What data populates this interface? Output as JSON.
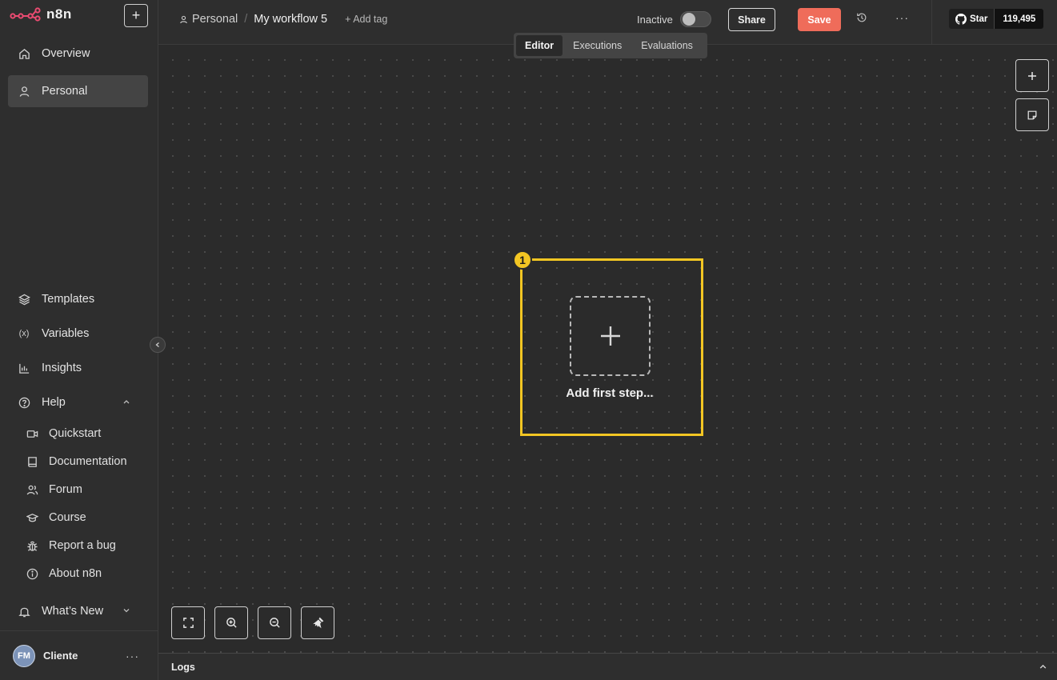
{
  "app": {
    "logo_text": "n8n",
    "new_button": "+"
  },
  "sidebar": {
    "top_items": [
      {
        "label": "Overview",
        "icon": "home-icon"
      },
      {
        "label": "Personal",
        "icon": "user-icon",
        "active": true
      }
    ],
    "bottom_items": [
      {
        "label": "Templates",
        "icon": "templates-icon"
      },
      {
        "label": "Variables",
        "icon": "variables-icon"
      },
      {
        "label": "Insights",
        "icon": "chart-icon"
      },
      {
        "label": "Help",
        "icon": "help-icon"
      }
    ],
    "help_items": [
      {
        "label": "Quickstart",
        "icon": "video-icon"
      },
      {
        "label": "Documentation",
        "icon": "book-icon"
      },
      {
        "label": "Forum",
        "icon": "users-icon"
      },
      {
        "label": "Course",
        "icon": "graduation-cap-icon"
      },
      {
        "label": "Report a bug",
        "icon": "bug-icon"
      },
      {
        "label": "About n8n",
        "icon": "info-icon"
      }
    ],
    "whats_new": "What’s New",
    "user": {
      "initials": "FM",
      "name": "Cliente"
    }
  },
  "header": {
    "project": "Personal",
    "separator": "/",
    "workflow_title": "My workflow 5",
    "add_tag": "+ Add tag",
    "status_label": "Inactive",
    "share_label": "Share",
    "save_label": "Save",
    "github": {
      "star_label": "Star",
      "count": "119,495"
    }
  },
  "tabs": [
    {
      "label": "Editor",
      "active": true
    },
    {
      "label": "Executions"
    },
    {
      "label": "Evaluations"
    }
  ],
  "canvas": {
    "add_first_step_label": "Add first step...",
    "highlight_badge": "1"
  },
  "logs": {
    "label": "Logs"
  },
  "colors": {
    "accent_save": "#ef6c5a",
    "highlight": "#f3c623"
  }
}
